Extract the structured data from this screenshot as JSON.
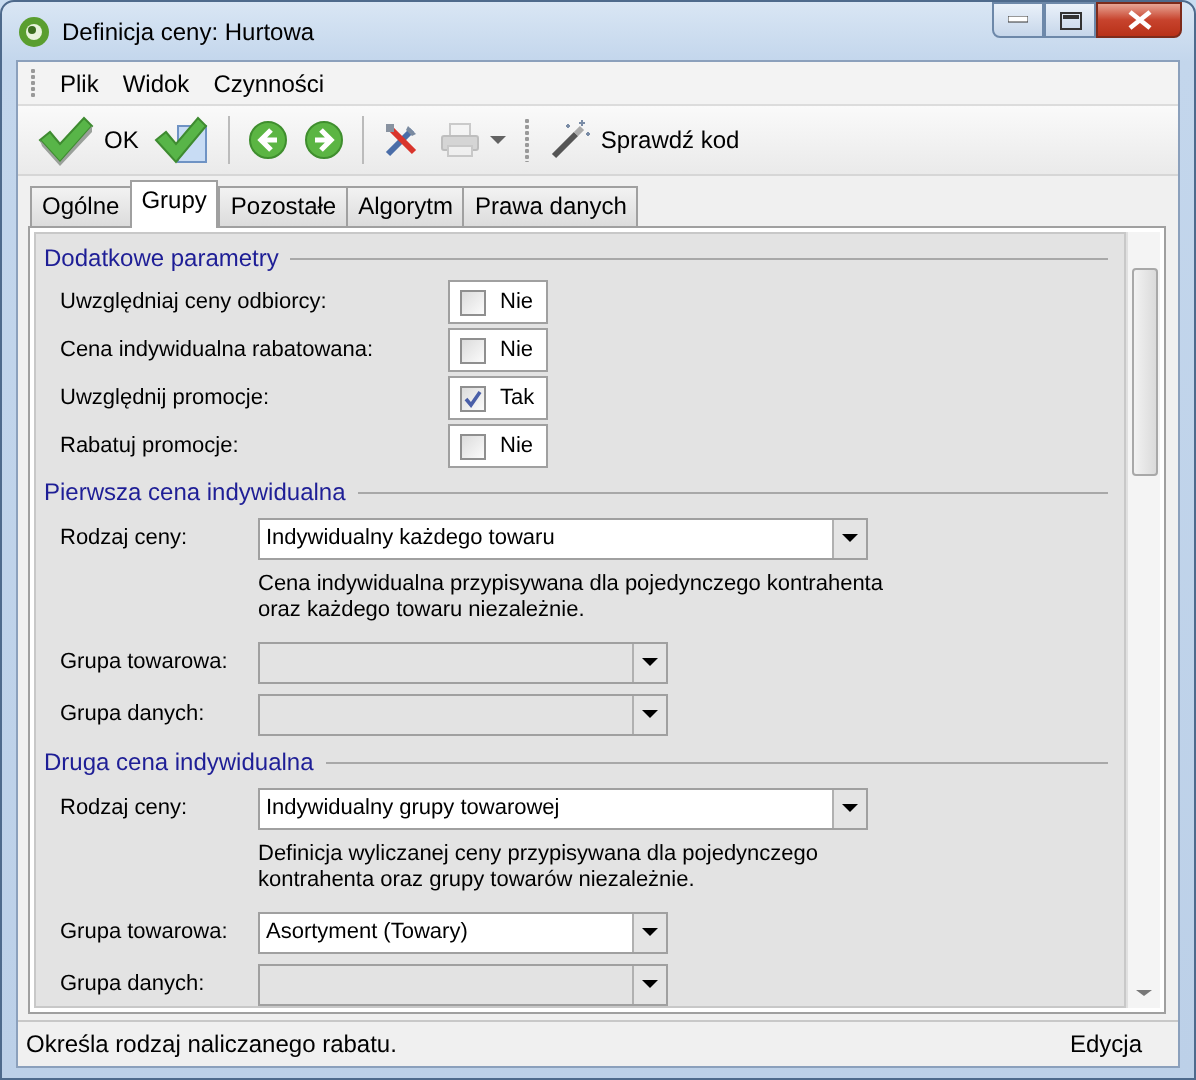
{
  "window": {
    "title": "Definicja ceny: Hurtowa"
  },
  "menu": [
    {
      "label": "Plik"
    },
    {
      "label": "Widok"
    },
    {
      "label": "Czynności"
    }
  ],
  "toolbar": [
    {
      "kind": "ok",
      "label": "OK",
      "disabled": false
    },
    {
      "kind": "save-close",
      "disabled": false
    },
    {
      "kind": "separator"
    },
    {
      "kind": "back",
      "disabled": false
    },
    {
      "kind": "forward",
      "disabled": false
    },
    {
      "kind": "separator"
    },
    {
      "kind": "tools",
      "disabled": false
    },
    {
      "kind": "print",
      "disabled": true
    },
    {
      "kind": "grip"
    },
    {
      "kind": "check-code",
      "label": "Sprawdź kod",
      "disabled": false
    }
  ],
  "tabs": [
    {
      "label": "Ogólne",
      "selected": false
    },
    {
      "label": "Grupy",
      "selected": true
    },
    {
      "label": "Pozostałe",
      "selected": false
    },
    {
      "label": "Algorytm",
      "selected": false
    },
    {
      "label": "Prawa danych",
      "selected": false
    }
  ],
  "sections": [
    {
      "title": "Dodatkowe parametry",
      "rows": [
        {
          "kind": "checkbox",
          "label": "Uwzględniaj ceny odbiorcy:",
          "checked": false,
          "value": "Nie"
        },
        {
          "kind": "checkbox",
          "label": "Cena indywidualna rabatowana:",
          "checked": false,
          "value": "Nie"
        },
        {
          "kind": "checkbox",
          "label": "Uwzględnij promocje:",
          "checked": true,
          "value": "Tak"
        },
        {
          "kind": "checkbox",
          "label": "Rabatuj promocje:",
          "checked": false,
          "value": "Nie"
        }
      ]
    },
    {
      "title": "Pierwsza cena indywidualna",
      "rows": [
        {
          "kind": "wide-combo",
          "label": "Rodzaj ceny:",
          "value": "Indywidualny każdego towaru",
          "disabled": false
        },
        {
          "kind": "note",
          "text": "Cena indywidualna przypisywana dla pojedynczego kontrahenta oraz każdego towaru niezależnie."
        },
        {
          "kind": "combo",
          "label": "Grupa towarowa:",
          "disabled": true
        },
        {
          "kind": "combo",
          "label": "Grupa danych:",
          "disabled": true
        }
      ]
    },
    {
      "title": "Druga cena indywidualna",
      "rows": [
        {
          "kind": "wide-combo",
          "label": "Rodzaj ceny:",
          "value": "Indywidualny grupy towarowej",
          "disabled": false
        },
        {
          "kind": "note",
          "text": "Definicja wyliczanej ceny przypisywana dla pojedynczego kontrahenta oraz grupy towarów niezależnie."
        },
        {
          "kind": "combo",
          "label": "Grupa towarowa:",
          "value": "Asortyment (Towary)",
          "disabled": false
        },
        {
          "kind": "combo",
          "label": "Grupa danych:",
          "disabled": true
        }
      ]
    }
  ],
  "status_bar": {
    "message": "Określa rodzaj naliczanego rabatu.",
    "mode": "Edycja"
  }
}
